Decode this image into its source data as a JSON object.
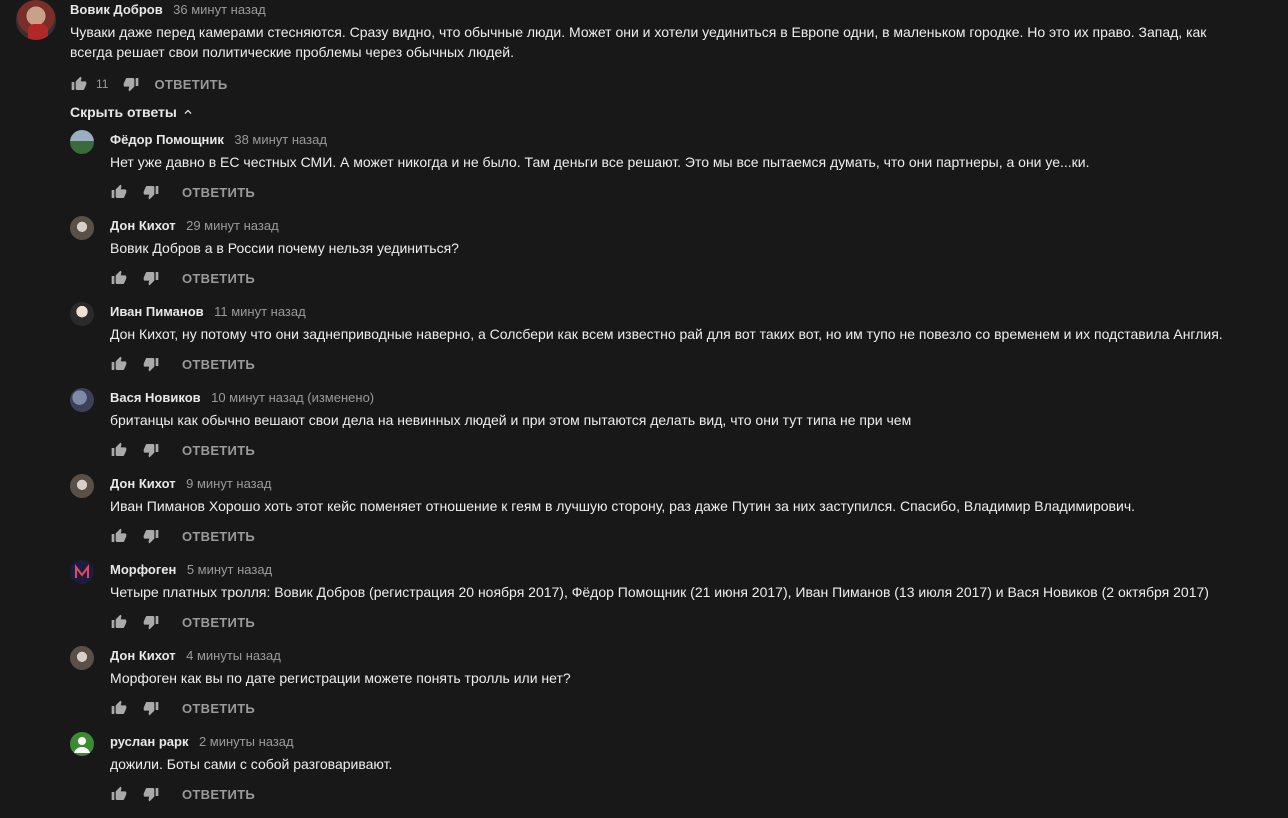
{
  "top_comment": {
    "author": "Вовик Добров",
    "time": "36 минут назад",
    "text": "Чуваки даже перед камерами стесняются. Сразу видно, что обычные люди. Может они и хотели уединиться в Европе одни, в маленьком городке. Но это их право. Запад, как всегда решает свои политические проблемы через обычных людей.",
    "likes": "11",
    "reply_label": "ОТВЕТИТЬ"
  },
  "toggle_replies": "Скрыть ответы",
  "replies": [
    {
      "author": "Фёдор Помощник",
      "time": "38 минут назад",
      "text": "Нет уже давно в ЕС честных СМИ. А может никогда и не было. Там деньги все решают. Это мы все пытаемся думать, что они партнеры, а они уе...ки.",
      "reply_label": "ОТВЕТИТЬ"
    },
    {
      "author": "Дон Кихот",
      "time": "29 минут назад",
      "text": "Вовик Добров а в России почему нельзя уединиться?",
      "reply_label": "ОТВЕТИТЬ"
    },
    {
      "author": "Иван Пиманов",
      "time": "11 минут назад",
      "text": "Дон Кихот, ну потому что они заднеприводные наверно, а Солсбери как всем известно рай для вот таких вот, но им тупо не повезло со временем и их подставила Англия.",
      "reply_label": "ОТВЕТИТЬ"
    },
    {
      "author": "Вася Новиков",
      "time": "10 минут назад (изменено)",
      "text": "британцы как обычно вешают свои дела на невинных людей и при этом пытаются делать вид, что они тут типа не при чем",
      "reply_label": "ОТВЕТИТЬ"
    },
    {
      "author": "Дон Кихот",
      "time": "9 минут назад",
      "text": "Иван Пиманов Хорошо хоть этот кейс поменяет отношение к геям в лучшую сторону, раз даже Путин за них заступился. Спасибо, Владимир Владимирович.",
      "reply_label": "ОТВЕТИТЬ"
    },
    {
      "author": "Морфоген",
      "time": "5 минут назад",
      "text": "Четыре платных тролля: Вовик Добров (регистрация 20 ноября 2017), Фёдор Помощник (21 июня 2017), Иван Пиманов (13 июля 2017) и Вася Новиков (2 октября 2017)",
      "reply_label": "ОТВЕТИТЬ"
    },
    {
      "author": "Дон Кихот",
      "time": "4 минуты назад",
      "text": "Морфоген как вы по дате регистрации можете понять тролль или нет?",
      "reply_label": "ОТВЕТИТЬ"
    },
    {
      "author": "руслан рарк",
      "time": "2 минуты назад",
      "text": "дожили. Боты сами с собой разговаривают.",
      "reply_label": "ОТВЕТИТЬ"
    }
  ],
  "icons": {
    "like": "thumb-up-icon",
    "dislike": "thumb-down-icon",
    "collapse": "chevron-up-icon"
  }
}
